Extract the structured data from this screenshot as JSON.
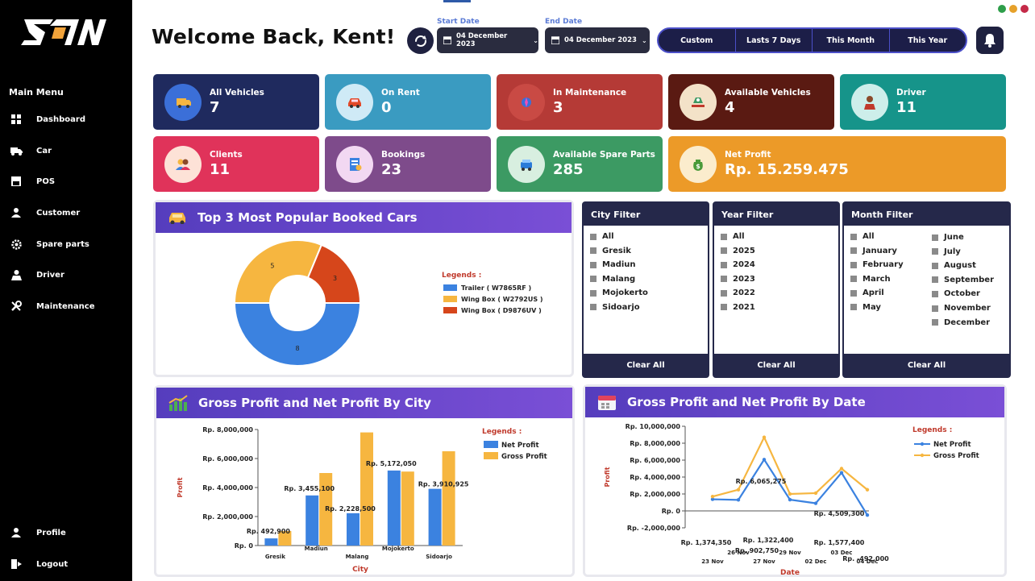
{
  "header": {
    "welcome": "Welcome Back, Kent!",
    "start_date_label": "Start Date",
    "start_date_value": "04 December 2023",
    "end_date_label": "End Date",
    "end_date_value": "04 December 2023",
    "ranges": [
      "Custom",
      "Lasts 7 Days",
      "This Month",
      "This Year"
    ],
    "icons": {
      "refresh": "refresh-icon",
      "calendar": "calendar-icon",
      "bell": "bell-icon"
    }
  },
  "sidebar": {
    "logo": "SJN",
    "menu_title": "Main Menu",
    "items": [
      {
        "label": "Dashboard",
        "icon": "dashboard-icon"
      },
      {
        "label": "Car",
        "icon": "truck-icon"
      },
      {
        "label": "POS",
        "icon": "pos-icon"
      },
      {
        "label": "Customer",
        "icon": "user-icon"
      },
      {
        "label": "Spare parts",
        "icon": "gear-icon"
      },
      {
        "label": "Driver",
        "icon": "driver-icon"
      },
      {
        "label": "Maintenance",
        "icon": "wrench-icon"
      }
    ],
    "bottom": [
      {
        "label": "Profile",
        "icon": "user-icon"
      },
      {
        "label": "Logout",
        "icon": "logout-icon"
      }
    ]
  },
  "stats": [
    {
      "title": "All Vehicles",
      "value": "7",
      "bg": "#1f2a5e",
      "icon_bg": "#3b6fd8",
      "icon": "truck-icon"
    },
    {
      "title": "On Rent",
      "value": "0",
      "bg": "#3a9bc1",
      "icon_bg": "#cfeaf6",
      "icon": "car-icon"
    },
    {
      "title": "In Maintenance",
      "value": "3",
      "bg": "#b53a36",
      "icon_bg": "#c94a44",
      "icon": "tools-icon"
    },
    {
      "title": "Available Vehicles",
      "value": "4",
      "bg": "#5a1a12",
      "icon_bg": "#f3e2c8",
      "icon": "vehicle-icon"
    },
    {
      "title": "Driver",
      "value": "11",
      "bg": "#16948a",
      "icon_bg": "#cdeeea",
      "icon": "driver-icon"
    },
    {
      "title": "Clients",
      "value": "11",
      "bg": "#e0335a",
      "icon_bg": "#fde2d7",
      "icon": "clients-icon"
    },
    {
      "title": "Bookings",
      "value": "23",
      "bg": "#7e4b8b",
      "icon_bg": "#f2d8f2",
      "icon": "booking-icon"
    },
    {
      "title": "Available Spare Parts",
      "value": "285",
      "bg": "#3c9a63",
      "icon_bg": "#d8efe0",
      "icon": "spare-icon"
    },
    {
      "title": "Net Profit",
      "value": "Rp. 15.259.475",
      "bg": "#ec9a28",
      "icon_bg": "#fbeccd",
      "icon": "money-bag-icon"
    }
  ],
  "donut": {
    "title": "Top 3 Most Popular Booked Cars",
    "legend_title": "Legends :",
    "chart_data": {
      "type": "pie",
      "categories": [
        "Trailer ( W7865RF )",
        "Wing Box ( W2792US )",
        "Wing Box ( D9876UV )"
      ],
      "values": [
        8,
        5,
        3
      ],
      "colors": [
        "#3b82e0",
        "#f6b640",
        "#d6461b"
      ]
    }
  },
  "filters": {
    "city": {
      "title": "City Filter",
      "items": [
        "All",
        "Gresik",
        "Madiun",
        "Malang",
        "Mojokerto",
        "Sidoarjo"
      ],
      "clear": "Clear All"
    },
    "year": {
      "title": "Year Filter",
      "items": [
        "All",
        "2025",
        "2024",
        "2023",
        "2022",
        "2021"
      ],
      "clear": "Clear All"
    },
    "month": {
      "title": "Month Filter",
      "items": [
        "All",
        "January",
        "February",
        "March",
        "April",
        "May",
        "June",
        "July",
        "August",
        "September",
        "October",
        "November",
        "December"
      ],
      "clear": "Clear All"
    }
  },
  "city_chart": {
    "title": "Gross Profit and Net Profit By City",
    "chart_data": {
      "type": "bar",
      "categories": [
        "Gresik",
        "Madiun",
        "Malang",
        "Mojokerto",
        "Sidoarjo"
      ],
      "series": [
        {
          "name": "Net Profit",
          "values": [
            492900,
            3455100,
            2228500,
            5172050,
            3910925
          ],
          "color": "#3b82e0"
        },
        {
          "name": "Gross Profit",
          "values": [
            1000000,
            5000000,
            7800000,
            5100000,
            6500000
          ],
          "color": "#f6b640"
        }
      ],
      "data_labels": [
        "Rp. 492,900",
        "Rp. 3,455,100",
        "Rp. 2,228,500",
        "Rp. 5,172,050",
        "Rp. 3,910,925"
      ],
      "xlabel": "City",
      "ylabel": "Profit",
      "ylim": [
        0,
        8000000
      ],
      "yticks": [
        "Rp. 8,000,000",
        "Rp. 6,000,000",
        "Rp. 4,000,000",
        "Rp. 2,000,000",
        "Rp. 0"
      ],
      "legend_title": "Legends :"
    }
  },
  "date_chart": {
    "title": "Gross Profit and Net Profit By Date",
    "chart_data": {
      "type": "line",
      "categories": [
        "23 Nov",
        "26 Nov",
        "27 Nov",
        "29 Nov",
        "02 Dec",
        "03 Dec",
        "04 Dec"
      ],
      "series": [
        {
          "name": "Net Profit",
          "values": [
            1374350,
            1300000,
            6065275,
            1322400,
            902750,
            4509300,
            -492000
          ],
          "color": "#3b82e0"
        },
        {
          "name": "Gross Profit",
          "values": [
            1700000,
            2500000,
            8700000,
            2000000,
            2100000,
            5000000,
            2500000
          ],
          "color": "#f6b640"
        }
      ],
      "data_labels": [
        "Rp. 1,374,350",
        "Rp. 6,065,275",
        "Rp. 1,322,400",
        "Rp. 902,750",
        "Rp. 4,509,300",
        "Rp. 1,577,400",
        "Rp. -492,000"
      ],
      "xlabel": "Date",
      "ylabel": "Profit",
      "ylim": [
        -2000000,
        10000000
      ],
      "yticks": [
        "Rp. 10,000,000",
        "Rp. 8,000,000",
        "Rp. 6,000,000",
        "Rp. 4,000,000",
        "Rp. 2,000,000",
        "Rp. 0",
        "Rp. -2,000,000"
      ],
      "legend_title": "Legends :"
    }
  }
}
